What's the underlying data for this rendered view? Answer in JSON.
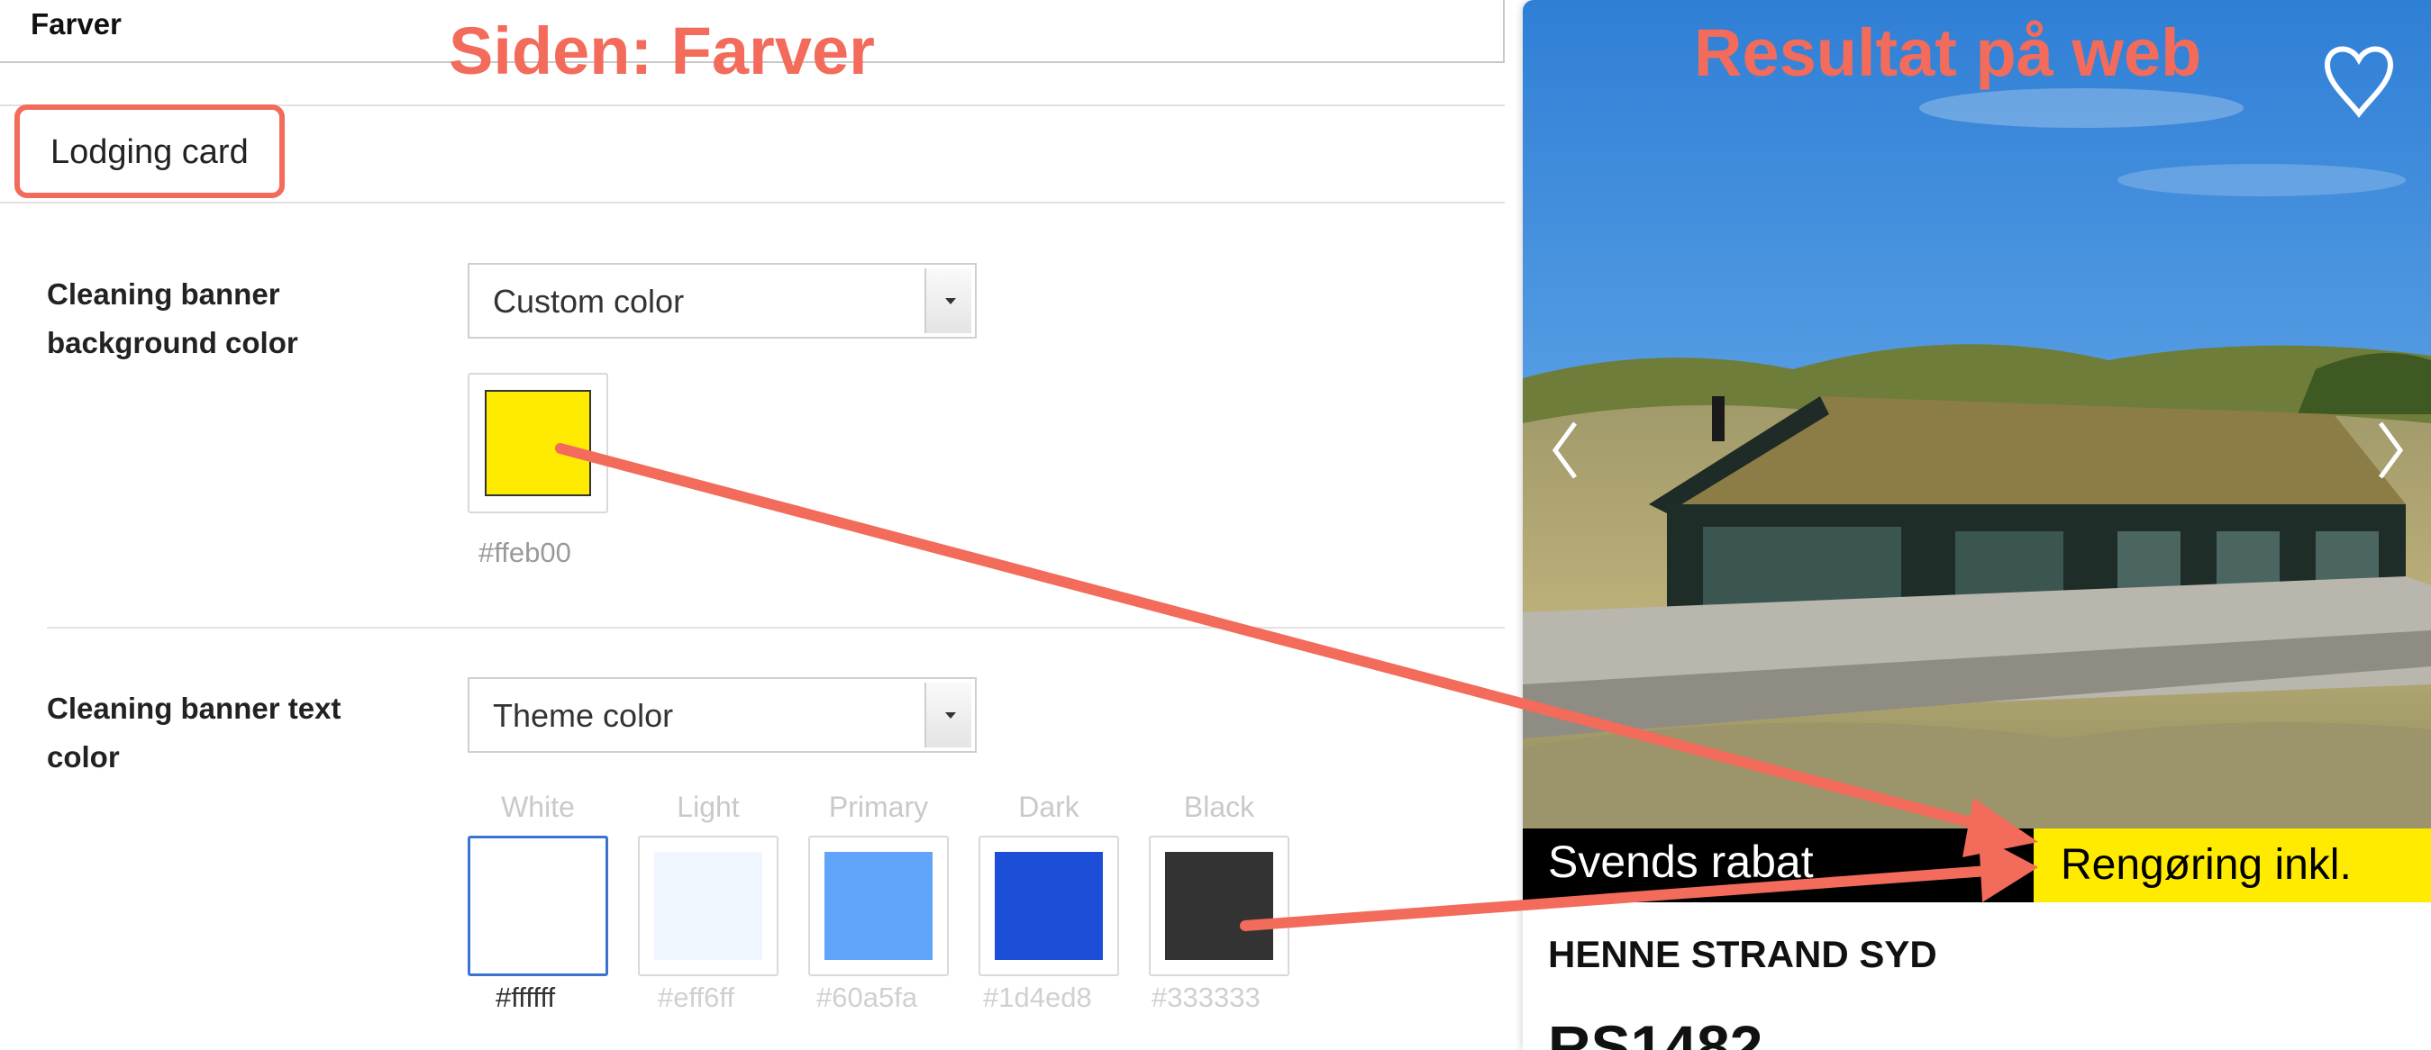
{
  "header": {
    "field_value": "Farver"
  },
  "annotations": {
    "left": "Siden: Farver",
    "right": "Resultat på web"
  },
  "tab": {
    "label": "Lodging card"
  },
  "cleaning_bg": {
    "label_line1": "Cleaning banner",
    "label_line2": "background color",
    "select_value": "Custom color",
    "color": "#ffeb00",
    "hex_label": "#ffeb00"
  },
  "cleaning_text": {
    "label_line1": "Cleaning banner text",
    "label_line2": "color",
    "select_value": "Theme color",
    "theme_options": [
      {
        "name": "White",
        "hex": "#ffffff",
        "selected": true
      },
      {
        "name": "Light",
        "hex": "#eff6ff",
        "selected": false
      },
      {
        "name": "Primary",
        "hex": "#60a5fa",
        "selected": false
      },
      {
        "name": "Dark",
        "hex": "#1d4ed8",
        "selected": false
      },
      {
        "name": "Black",
        "hex": "#333333",
        "selected": false
      }
    ]
  },
  "preview": {
    "discount_banner": "Svends rabat",
    "cleaning_banner": "Rengøring inkl.",
    "location": "HENNE STRAND SYD",
    "code": "RS1482",
    "cleaning_banner_bg": "#ffeb00",
    "cleaning_banner_text": "#000000"
  },
  "colors": {
    "accent": "#f26b5b"
  }
}
